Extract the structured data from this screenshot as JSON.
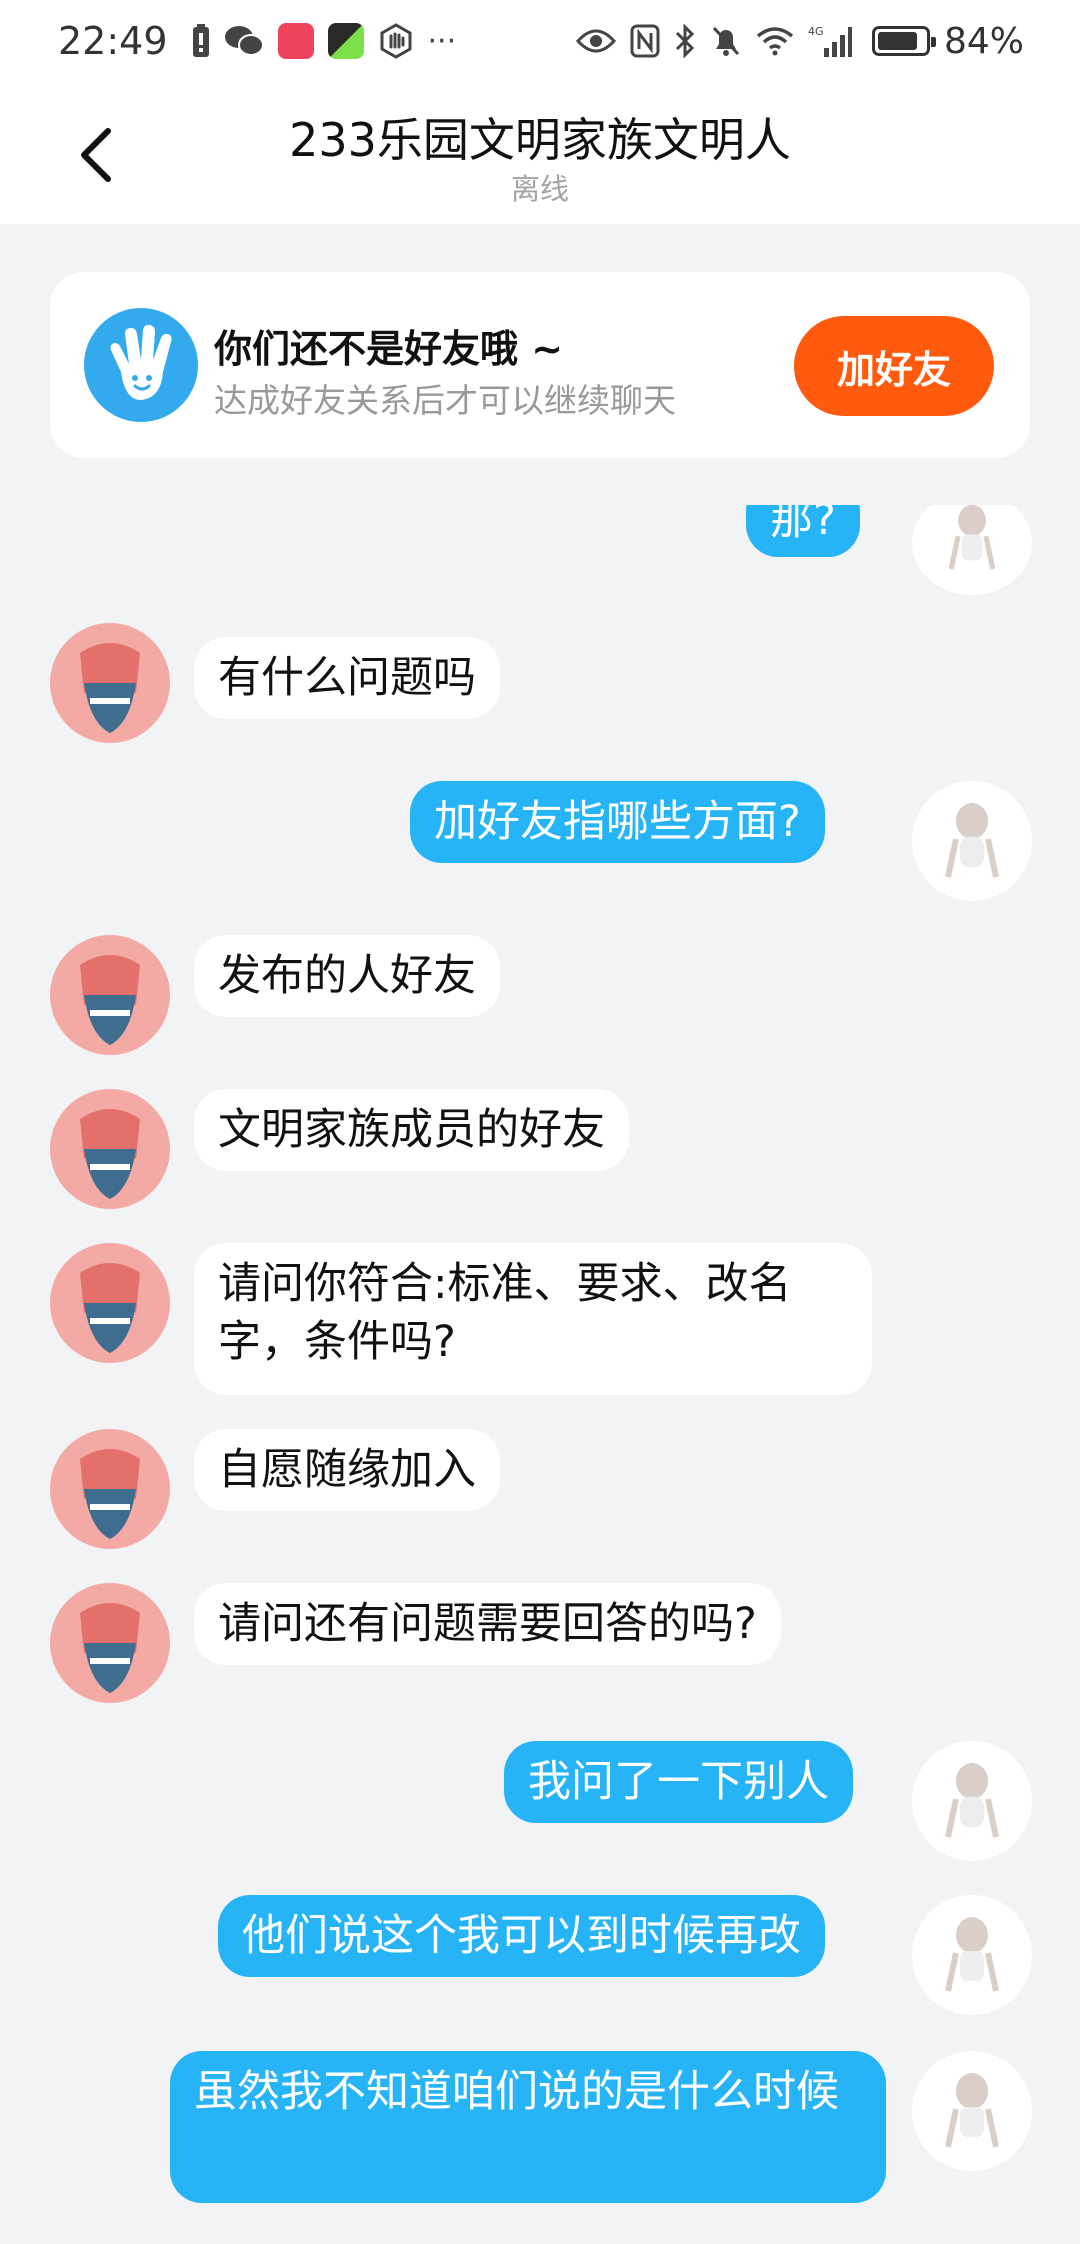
{
  "status_bar": {
    "time": "22:49",
    "more": "···",
    "network": "4G",
    "battery_percent": "84%",
    "battery_level": 0.84
  },
  "header": {
    "title": "233乐园文明家族文明人",
    "subtitle": "离线"
  },
  "friend_banner": {
    "title": "你们还不是好友哦 ~",
    "description": "达成好友关系后才可以继续聊天",
    "add_button": "加好友"
  },
  "messages": [
    {
      "side": "out",
      "text": "那?"
    },
    {
      "side": "in",
      "text": "有什么问题吗"
    },
    {
      "side": "out",
      "text": "加好友指哪些方面?"
    },
    {
      "side": "in",
      "text": "发布的人好友"
    },
    {
      "side": "in",
      "text": "文明家族成员的好友"
    },
    {
      "side": "in",
      "text": "请问你符合:标准、要求、改名字，条件吗?"
    },
    {
      "side": "in",
      "text": "自愿随缘加入"
    },
    {
      "side": "in",
      "text": "请问还有问题需要回答的吗?"
    },
    {
      "side": "out",
      "text": "我问了一下别人"
    },
    {
      "side": "out",
      "text": "他们说这个我可以到时候再改"
    },
    {
      "side": "out",
      "text": "虽然我不知道咱们说的是什么时候"
    }
  ],
  "colors": {
    "accent_blue": "#27b4f7",
    "add_friend_orange": "#ff5a0e",
    "background": "#f2f3f5"
  }
}
